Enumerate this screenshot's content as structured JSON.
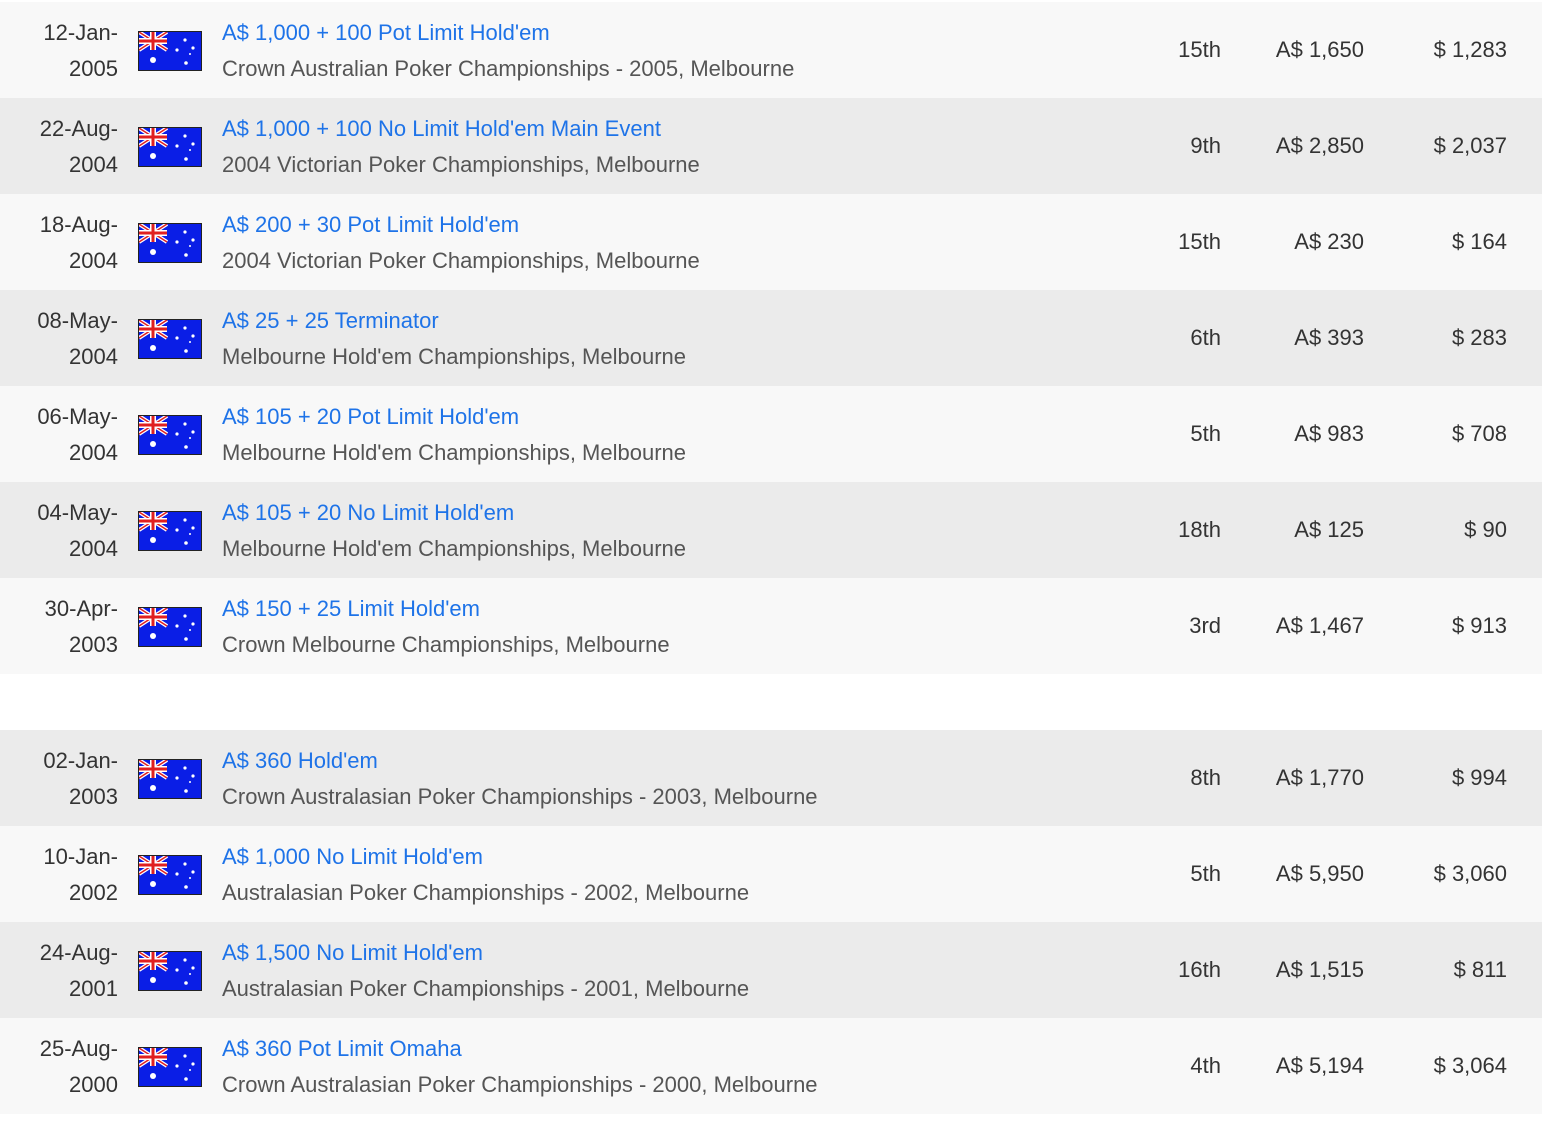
{
  "colors": {
    "link": "#1e73e8",
    "text": "#333333",
    "subtext": "#555555",
    "row_odd": "#f8f8f8",
    "row_even": "#ebebeb"
  },
  "flag_icon": "australia-flag-icon",
  "groups": [
    {
      "rows": [
        {
          "date_line1": "12-Jan-",
          "date_line2": "2005",
          "event": "A$ 1,000 + 100 Pot Limit Hold'em",
          "venue": "Crown Australian Poker Championships - 2005, Melbourne",
          "place": "15th",
          "prize": "A$ 1,650",
          "usd": "$ 1,283"
        },
        {
          "date_line1": "22-Aug-",
          "date_line2": "2004",
          "event": "A$ 1,000 + 100 No Limit Hold'em Main Event",
          "venue": "2004 Victorian Poker Championships, Melbourne",
          "place": "9th",
          "prize": "A$ 2,850",
          "usd": "$ 2,037"
        },
        {
          "date_line1": "18-Aug-",
          "date_line2": "2004",
          "event": "A$ 200 + 30 Pot Limit Hold'em",
          "venue": "2004 Victorian Poker Championships, Melbourne",
          "place": "15th",
          "prize": "A$ 230",
          "usd": "$ 164"
        },
        {
          "date_line1": "08-May-",
          "date_line2": "2004",
          "event": "A$ 25 + 25 Terminator",
          "venue": "Melbourne Hold'em Championships, Melbourne",
          "place": "6th",
          "prize": "A$ 393",
          "usd": "$ 283"
        },
        {
          "date_line1": "06-May-",
          "date_line2": "2004",
          "event": "A$ 105 + 20 Pot Limit Hold'em",
          "venue": "Melbourne Hold'em Championships, Melbourne",
          "place": "5th",
          "prize": "A$ 983",
          "usd": "$ 708"
        },
        {
          "date_line1": "04-May-",
          "date_line2": "2004",
          "event": "A$ 105 + 20 No Limit Hold'em",
          "venue": "Melbourne Hold'em Championships, Melbourne",
          "place": "18th",
          "prize": "A$ 125",
          "usd": "$ 90"
        },
        {
          "date_line1": "30-Apr-",
          "date_line2": "2003",
          "event": "A$ 150 + 25 Limit Hold'em",
          "venue": "Crown Melbourne Championships, Melbourne",
          "place": "3rd",
          "prize": "A$ 1,467",
          "usd": "$ 913"
        }
      ]
    },
    {
      "rows": [
        {
          "date_line1": "02-Jan-",
          "date_line2": "2003",
          "event": "A$ 360 Hold'em",
          "venue": "Crown Australasian Poker Championships - 2003, Melbourne",
          "place": "8th",
          "prize": "A$ 1,770",
          "usd": "$ 994"
        },
        {
          "date_line1": "10-Jan-",
          "date_line2": "2002",
          "event": "A$ 1,000 No Limit Hold'em",
          "venue": "Australasian Poker Championships - 2002, Melbourne",
          "place": "5th",
          "prize": "A$ 5,950",
          "usd": "$ 3,060"
        },
        {
          "date_line1": "24-Aug-",
          "date_line2": "2001",
          "event": "A$ 1,500 No Limit Hold'em",
          "venue": "Australasian Poker Championships - 2001, Melbourne",
          "place": "16th",
          "prize": "A$ 1,515",
          "usd": "$ 811"
        },
        {
          "date_line1": "25-Aug-",
          "date_line2": "2000",
          "event": "A$ 360 Pot Limit Omaha",
          "venue": "Crown Australasian Poker Championships - 2000, Melbourne",
          "place": "4th",
          "prize": "A$ 5,194",
          "usd": "$ 3,064"
        }
      ]
    }
  ]
}
